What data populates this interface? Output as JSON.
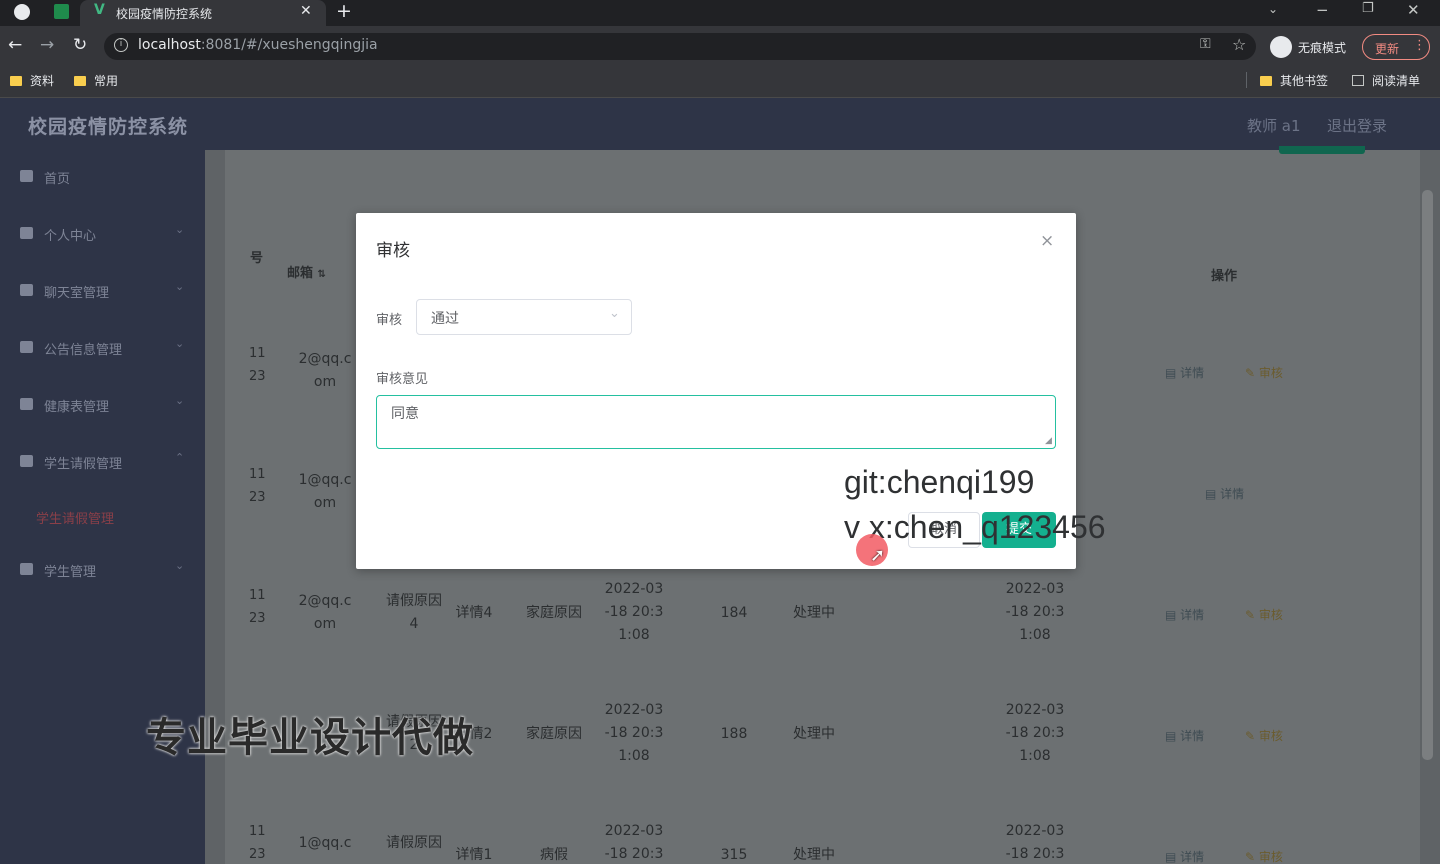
{
  "browser": {
    "tab_title": "校园疫情防控系统",
    "url_host": "localhost",
    "url_rest": ":8081/#/xueshengqingjia",
    "incognito_label": "无痕模式",
    "update_label": "更新",
    "bookmarks": [
      "资料",
      "常用"
    ],
    "other_bookmarks": "其他书签",
    "reading_list": "阅读清单"
  },
  "app": {
    "title": "校园疫情防控系统",
    "user": "教师 a1",
    "logout": "退出登录"
  },
  "sidebar": {
    "items": [
      {
        "label": "首页"
      },
      {
        "label": "个人中心"
      },
      {
        "label": "聊天室管理"
      },
      {
        "label": "公告信息管理"
      },
      {
        "label": "健康表管理"
      },
      {
        "label": "学生请假管理"
      },
      {
        "label": "学生管理"
      }
    ],
    "active_sub": "学生请假管理"
  },
  "table": {
    "headers": {
      "num": "号",
      "email": "邮箱",
      "ops": "操作"
    },
    "detail_label": "详情",
    "review_label": "审核",
    "rows": [
      {
        "id": "11 23",
        "email": [
          "2@qq.c",
          "om"
        ]
      },
      {
        "id": "11 23",
        "email": [
          "1@qq.c",
          "om"
        ]
      },
      {
        "id": "11 23",
        "email": [
          "2@qq.c",
          "om"
        ],
        "reason": [
          "请假原因",
          "4"
        ],
        "detail": "详情4",
        "type": "家庭原因",
        "time": [
          "2022-03",
          "-18 20:3",
          "1:08"
        ],
        "days": "184",
        "status": "处理中",
        "time2": [
          "2022-03",
          "-18 20:3",
          "1:08"
        ]
      },
      {
        "id": "",
        "email": [
          "",
          ""
        ],
        "reason": [
          "请假原因",
          "2"
        ],
        "detail": "详情2",
        "type": "家庭原因",
        "time": [
          "2022-03",
          "-18 20:3",
          "1:08"
        ],
        "days": "188",
        "status": "处理中",
        "time2": [
          "2022-03",
          "-18 20:3",
          "1:08"
        ]
      },
      {
        "id": "11 23",
        "email": [
          "1@qq.c",
          ""
        ],
        "reason": [
          "请假原因",
          ""
        ],
        "detail": "详情1",
        "type": "病假",
        "time": [
          "2022-03",
          "-18 20:3",
          ""
        ],
        "days": "315",
        "status": "处理中",
        "time2": [
          "2022-03",
          "-18 20:3",
          ""
        ]
      }
    ]
  },
  "modal": {
    "title": "审核",
    "close": "×",
    "field_review": "审核",
    "review_value": "通过",
    "field_opinion": "审核意见",
    "opinion_value": "同意",
    "cancel": "取消",
    "submit": "提交"
  },
  "overlay": {
    "git": "git:chenqi199",
    "vx": "v x:chen_q123456",
    "banner": "专业毕业设计代做"
  }
}
